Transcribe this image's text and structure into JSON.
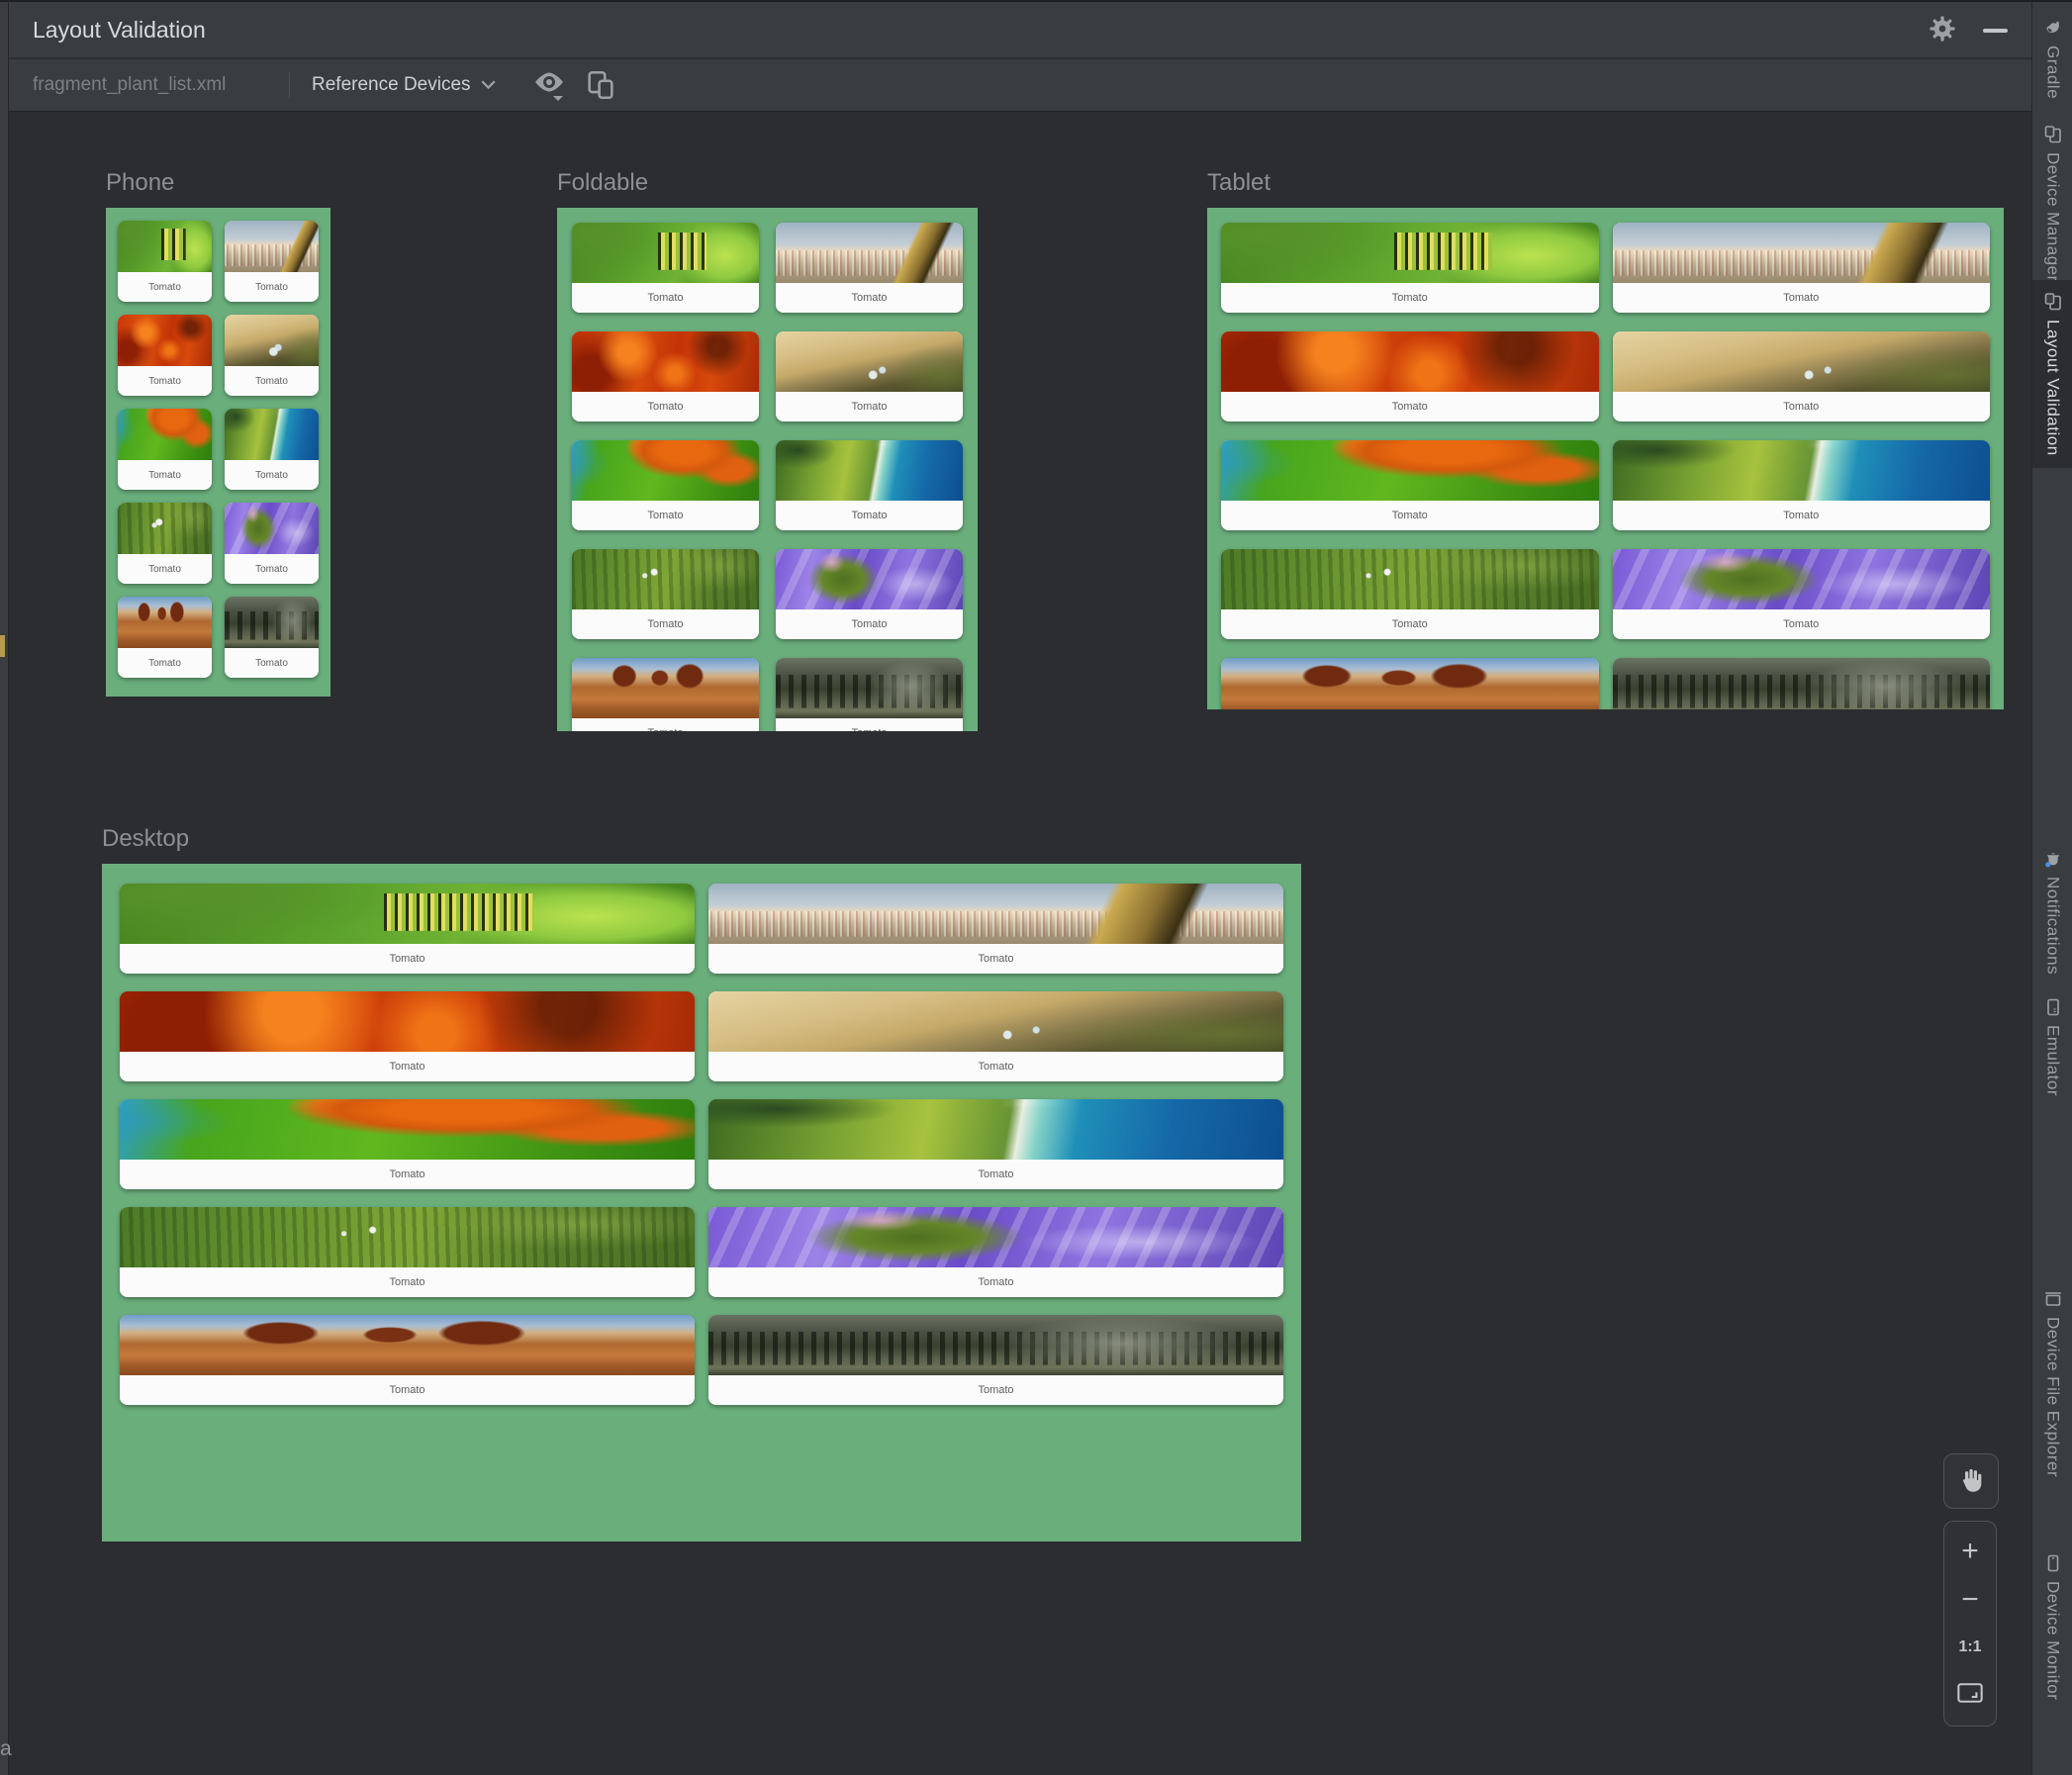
{
  "window": {
    "title": "Layout Validation"
  },
  "toolbar": {
    "file_tab": "fragment_plant_list.xml",
    "devices_dropdown": "Reference Devices",
    "icons": [
      "visibility-eye-icon",
      "copy-layers-icon"
    ]
  },
  "titlebar_icons": [
    "gear-icon",
    "minimize-icon"
  ],
  "canvas": {
    "card_label": "Tomato",
    "previews": [
      {
        "id": "phone",
        "title": "Phone",
        "images": [
          "caterpillar",
          "telescope",
          "red-maple",
          "water-droplet",
          "maple-on-green",
          "coastline",
          "farm-aerial",
          "purple-river",
          "desert",
          "forest"
        ]
      },
      {
        "id": "foldable",
        "title": "Foldable",
        "images": [
          "caterpillar",
          "telescope",
          "red-maple",
          "water-droplet",
          "maple-on-green",
          "coastline",
          "farm-aerial",
          "purple-river",
          "desert",
          "forest"
        ]
      },
      {
        "id": "tablet",
        "title": "Tablet",
        "images": [
          "caterpillar",
          "telescope",
          "red-maple",
          "water-droplet",
          "maple-on-green",
          "coastline",
          "farm-aerial",
          "purple-river",
          "desert",
          "forest"
        ]
      },
      {
        "id": "desktop",
        "title": "Desktop",
        "images": [
          "caterpillar",
          "telescope",
          "red-maple",
          "water-droplet",
          "maple-on-green",
          "coastline",
          "farm-aerial",
          "purple-river",
          "desert",
          "forest"
        ]
      }
    ]
  },
  "zoom_controls": {
    "pan": "pan-hand",
    "zoom_in": "+",
    "zoom_out": "−",
    "actual_size": "1:1",
    "fit": "fit-screen"
  },
  "sidebar": {
    "active": "Layout Validation",
    "tabs": [
      {
        "id": "gradle",
        "label": "Gradle",
        "icon": "gradle-elephant-icon"
      },
      {
        "id": "device-manager",
        "label": "Device Manager",
        "icon": "devices-icon"
      },
      {
        "id": "layout-validation",
        "label": "Layout Validation",
        "icon": "devices-icon"
      },
      {
        "id": "notifications",
        "label": "Notifications",
        "icon": "bell-icon"
      },
      {
        "id": "emulator",
        "label": "Emulator",
        "icon": "emulator-icon"
      },
      {
        "id": "device-file-explorer",
        "label": "Device File Explorer",
        "icon": "laptop-icon"
      },
      {
        "id": "device-monitor",
        "label": "Device Monitor",
        "icon": "phone-icon"
      }
    ]
  },
  "colors": {
    "panel_green": "#6aae7c",
    "canvas_bg": "#2b2d30",
    "chrome_bg": "#3a3d40",
    "notification_badge_blue": "#4a8fe8"
  },
  "corner_text": "a"
}
